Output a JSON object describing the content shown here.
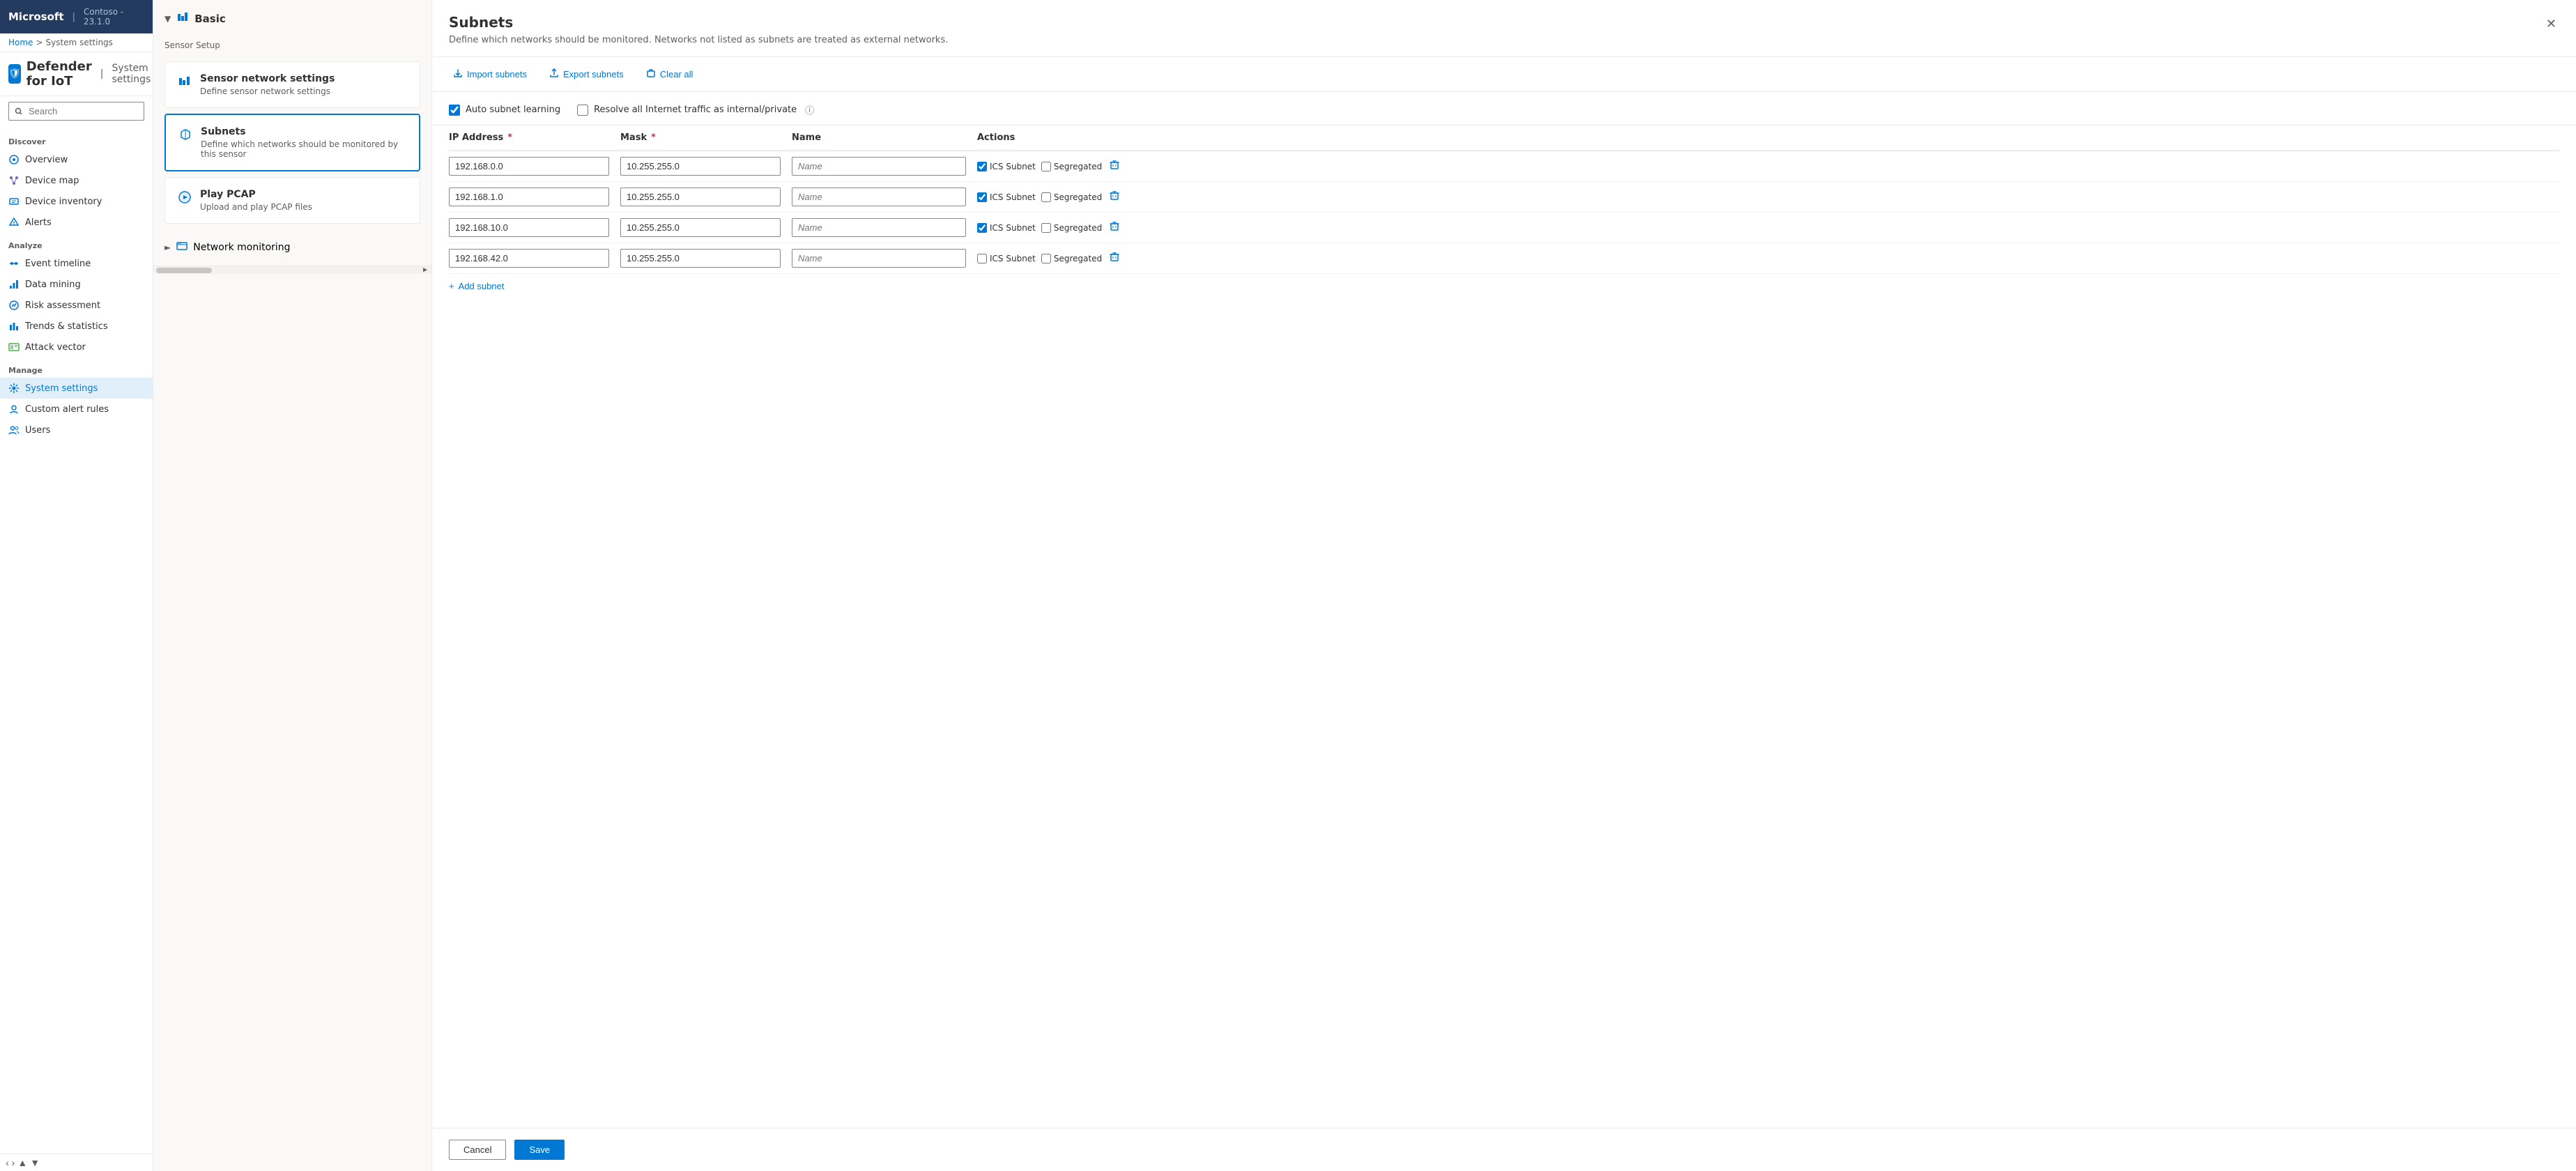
{
  "topbar": {
    "brand": "Microsoft",
    "separator": "|",
    "instance": "Contoso - 23.1.0"
  },
  "breadcrumb": {
    "home": "Home",
    "separator": ">",
    "current": "System settings"
  },
  "appTitle": {
    "icon": "🛡",
    "name": "Defender for IoT",
    "divider": "|",
    "sub": "System settings"
  },
  "search": {
    "placeholder": "Search"
  },
  "sidebar": {
    "discover_label": "Discover",
    "items_discover": [
      {
        "id": "overview",
        "label": "Overview",
        "icon": "globe"
      },
      {
        "id": "device-map",
        "label": "Device map",
        "icon": "map"
      },
      {
        "id": "device-inventory",
        "label": "Device inventory",
        "icon": "inventory"
      },
      {
        "id": "alerts",
        "label": "Alerts",
        "icon": "bell"
      }
    ],
    "analyze_label": "Analyze",
    "items_analyze": [
      {
        "id": "event-timeline",
        "label": "Event timeline",
        "icon": "timeline"
      },
      {
        "id": "data-mining",
        "label": "Data mining",
        "icon": "data"
      },
      {
        "id": "risk-assessment",
        "label": "Risk assessment",
        "icon": "risk"
      },
      {
        "id": "trends-statistics",
        "label": "Trends & statistics",
        "icon": "trends"
      },
      {
        "id": "attack-vector",
        "label": "Attack vector",
        "icon": "attack"
      }
    ],
    "manage_label": "Manage",
    "items_manage": [
      {
        "id": "system-settings",
        "label": "System settings",
        "icon": "settings"
      },
      {
        "id": "custom-alert-rules",
        "label": "Custom alert rules",
        "icon": "alert-rules"
      },
      {
        "id": "users",
        "label": "Users",
        "icon": "users"
      }
    ]
  },
  "middle": {
    "basic_label": "Basic",
    "sensor_setup_label": "Sensor Setup",
    "cards": [
      {
        "id": "sensor-network-settings",
        "title": "Sensor network settings",
        "desc": "Define sensor network settings",
        "icon": "chart"
      },
      {
        "id": "subnets",
        "title": "Subnets",
        "desc": "Define which networks should be monitored by this sensor",
        "icon": "code",
        "active": true
      },
      {
        "id": "play-pcap",
        "title": "Play PCAP",
        "desc": "Upload and play PCAP files",
        "icon": "play"
      }
    ],
    "network_monitoring_label": "Network monitoring"
  },
  "drawer": {
    "title": "Subnets",
    "subtitle": "Define which networks should be monitored. Networks not listed as subnets are treated as external networks.",
    "toolbar": {
      "import_label": "Import subnets",
      "export_label": "Export subnets",
      "clear_all_label": "Clear all"
    },
    "options": {
      "auto_subnet_learning": "Auto subnet learning",
      "resolve_internet_traffic": "Resolve all Internet traffic as internal/private"
    },
    "table": {
      "headers": [
        {
          "label": "IP Address",
          "required": true
        },
        {
          "label": "Mask",
          "required": true
        },
        {
          "label": "Name",
          "required": false
        },
        {
          "label": "Actions",
          "required": false
        }
      ],
      "rows": [
        {
          "ip": "192.168.0.0",
          "mask": "10.255.255.0",
          "name": "",
          "ics_checked": true,
          "segregated_checked": false
        },
        {
          "ip": "192.168.1.0",
          "mask": "10.255.255.0",
          "name": "",
          "ics_checked": true,
          "segregated_checked": false
        },
        {
          "ip": "192.168.10.0",
          "mask": "10.255.255.0",
          "name": "",
          "ics_checked": true,
          "segregated_checked": false
        },
        {
          "ip": "192.168.42.0",
          "mask": "10.255.255.0",
          "name": "",
          "ics_checked": false,
          "segregated_checked": false
        }
      ],
      "name_placeholder": "Name"
    },
    "add_subnet_label": "+ Add subnet",
    "footer": {
      "cancel_label": "Cancel",
      "save_label": "Save"
    }
  }
}
